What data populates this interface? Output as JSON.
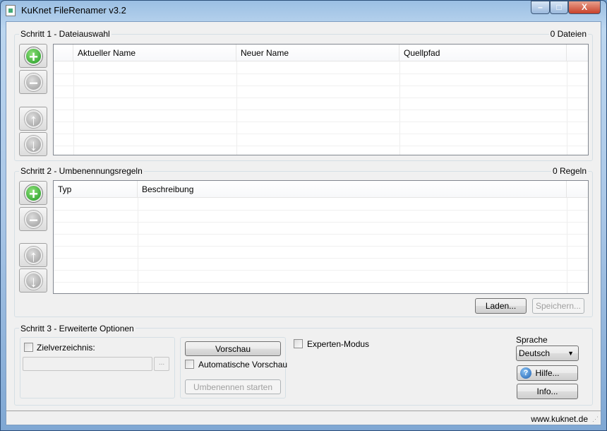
{
  "window": {
    "title": "KuKnet FileRenamer v3.2",
    "minimize": "–",
    "maximize": "□",
    "close": "X"
  },
  "step1": {
    "title": "Schritt 1 - Dateiauswahl",
    "count": "0 Dateien",
    "columns": [
      "Aktueller Name",
      "Neuer Name",
      "Quellpfad"
    ]
  },
  "step2": {
    "title": "Schritt 2 - Umbenennungsregeln",
    "count": "0 Regeln",
    "columns": [
      "Typ",
      "Beschreibung"
    ],
    "load": "Laden...",
    "save": "Speichern..."
  },
  "step3": {
    "title": "Schritt 3 - Erweiterte Optionen",
    "target_dir": "Zielverzeichnis:",
    "target_value": "",
    "browse": "...",
    "preview": "Vorschau",
    "auto_preview": "Automatische Vorschau",
    "start": "Umbenennen starten",
    "expert": "Experten-Modus",
    "language_label": "Sprache",
    "language": "Deutsch",
    "help": "Hilfe...",
    "info": "Info..."
  },
  "status": {
    "url": "www.kuknet.de"
  }
}
